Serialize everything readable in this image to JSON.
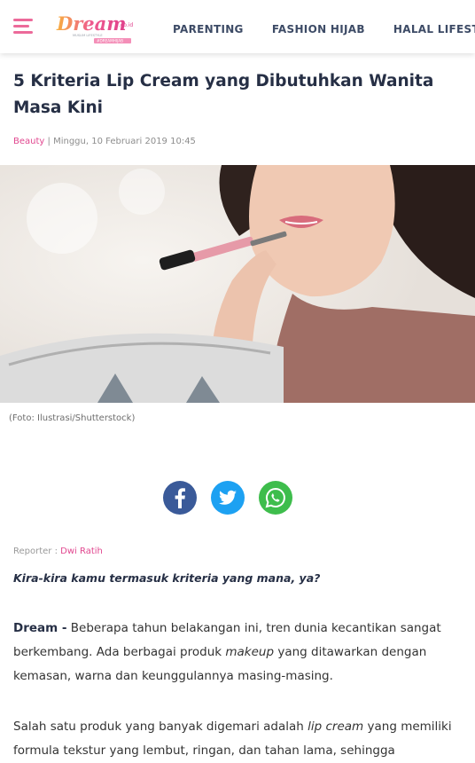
{
  "header": {
    "logo_text": "Dream",
    "logo_suffix": ".co.id",
    "logo_tagline": "MUSLIM LIFESTYLE",
    "logo_badge": "#DREAMHIJAB",
    "nav": [
      "PARENTING",
      "FASHION HIJAB",
      "HALAL LIFESTYLE"
    ]
  },
  "article": {
    "title": "5 Kriteria Lip Cream yang Dibutuhkan Wanita Masa Kini",
    "category": "Beauty",
    "separator": "|",
    "date": "Minggu, 10 Februari 2019 10:45",
    "image_caption": "(Foto: Ilustrasi/Shutterstock)",
    "reporter_label": "Reporter :",
    "reporter_name": "Dwi Ratih",
    "lead": "Kira-kira kamu termasuk kriteria yang mana, ya?",
    "p1": {
      "dateline": "Dream -",
      "text_a": "Beberapa tahun belakangan ini, tren dunia kecantikan sangat berkembang. Ada berbagai produk",
      "em": "makeup",
      "text_b": "yang ditawarkan dengan kemasan, warna dan keunggulannya masing-masing."
    },
    "p2": {
      "text_a": "Salah satu produk yang banyak digemari adalah",
      "em": "lip cream",
      "text_b": "yang memiliki formula tekstur yang lembut, ringan, dan tahan lama, sehingga"
    }
  },
  "share": {
    "icons": [
      "facebook-icon",
      "twitter-icon",
      "whatsapp-icon"
    ],
    "colors": {
      "facebook": "#3a5a99",
      "twitter": "#1da1f2",
      "whatsapp": "#3ebd4c"
    }
  },
  "colors": {
    "accent": "#e1478f",
    "menu": "#ec6a9a",
    "nav": "#3d4b66",
    "title": "#262f45"
  }
}
